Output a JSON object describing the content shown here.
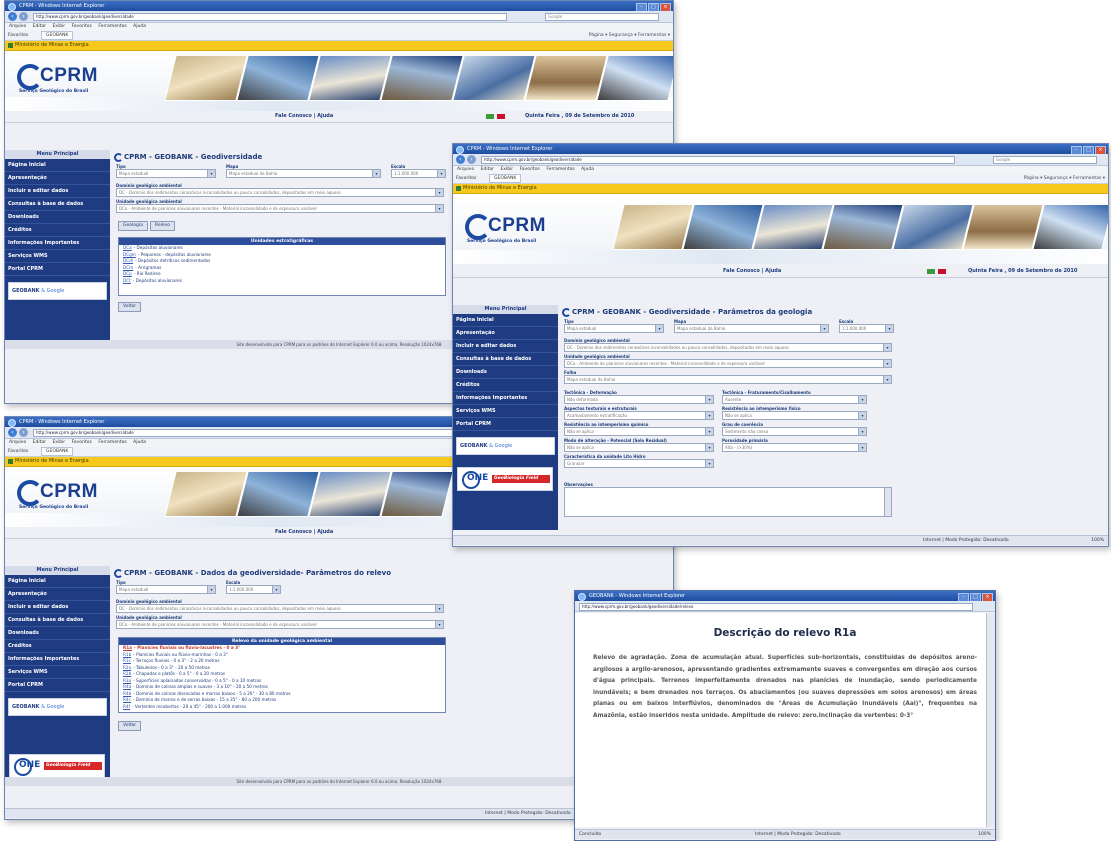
{
  "browser": {
    "window_title": "CPRM - Windows Internet Explorer",
    "url": "http://www.cprm.gov.br/geobank/geodiversidade",
    "search_placeholder": "Google",
    "menu": [
      "Arquivo",
      "Editar",
      "Exibir",
      "Favoritos",
      "Ferramentas",
      "Ajuda"
    ],
    "favorites_label": "Favoritos",
    "tab_label": "GEOBANK",
    "tools": "Página ▾  Segurança ▾  Ferramentas ▾",
    "ministry_bar": "Ministério de Minas e Energia"
  },
  "site": {
    "logo_text": "CPRM",
    "logo_sub": "Serviço Geológico do Brasil",
    "contact": "Fale Conosco | Ajuda",
    "date": "Quinta Feira , 09 de Setembro de 2010",
    "sidebar_head": "Menu Principal",
    "sidebar_items": [
      "Página Inicial",
      "Apresentação",
      "Incluir e editar dados",
      "Consultas à base de dados",
      "Downloads",
      "Créditos",
      "Informações Importantes",
      "Serviços WMS",
      "Portal CPRM"
    ],
    "geobank_label": "GEOBANK",
    "google_label": "& Google",
    "one_label": "ONE",
    "one_tag": "GeoBiologia Field",
    "footer_text": "Site desenvolvido para CPRM para os padrões do Internet Explorer 6.0 ou acima. Resolução 1024x768",
    "status_done": "Concluído",
    "status_zone": "Internet | Modo Protegido: Desativado",
    "status_zoom": "100%"
  },
  "window1": {
    "page_title": "CPRM - GEOBANK - Geodiversidade",
    "labels": {
      "tipo": "Tipo",
      "mapa": "Mapa",
      "escala": "Escala",
      "dominio": "Domínio geológico ambiental",
      "unidade": "Unidade geológica ambiental"
    },
    "values": {
      "tipo": "Mapa estadual",
      "mapa": "Mapa estadual da Bahia",
      "escala": "1:1.000.000",
      "dominio": "DC - Domínio dos sedimentos cenozóicos inconsolidados ou pouco consolidados, depositados em meio aquoso",
      "unidade": "DCa - Ambiente de planícies aluvionares recentes - Material inconsolidado e de espessura variável"
    },
    "buttons": [
      "Geologia",
      "Relevo"
    ],
    "legend_title": "Unidades estratigráficas",
    "legend_rows": [
      {
        "code": "DCa",
        "text": "- Depósitos aluvionares"
      },
      {
        "code": "DCgm",
        "text": "- Pequenos - depósitos aluvionares"
      },
      {
        "code": "DCdl",
        "text": "- Depósitos detríticos sedimentados"
      },
      {
        "code": "DCm",
        "text": "- Arrigramas"
      },
      {
        "code": "DCp",
        "text": "- Rio Redireo"
      },
      {
        "code": "DCt",
        "text": "- Depósitos aluvionares"
      }
    ],
    "back_button": "Voltar"
  },
  "window2": {
    "page_title": "CPRM - GEOBANK - Geodiversidade - Parâmetros da geologia",
    "labels": {
      "tipo": "Tipo",
      "mapa": "Mapa",
      "escala": "Escala",
      "dominio": "Domínio geológico ambiental",
      "unidade": "Unidade geológica ambiental",
      "folha": "Folha",
      "tectonica_def": "Tectônica - Deformação",
      "tectonica_frat": "Tectônica - Fraturamento/Cisalhamento",
      "aspectos": "Aspectos texturais e estruturais",
      "resist_intemp_fisico": "Resistência ao intemperismo físico",
      "resist_intemp_quimico": "Resistência ao intemperismo químico",
      "grau_coerencia": "Grau de coerência",
      "porosidade": "Porosidade primária",
      "modo_alteracao": "Modo de alteração - Potencial (Solo Residual)",
      "caracteristica": "Característica da unidade Lito Hidro",
      "observacoes": "Observações"
    },
    "values": {
      "tipo": "Mapa estadual",
      "mapa": "Mapa estadual da Bahia",
      "escala": "1:1.000.000",
      "dominio": "DC - Domínio dos sedimentos cenozóicos inconsolidados ou pouco consolidados, depositados em meio aquoso",
      "unidade": "DCa - Ambiente de planícies aluvionares recentes - Material inconsolidado e de espessura variável",
      "folha": "Mapa estadual da Bahia",
      "tectonica_def": "Não deformada",
      "tectonica_frat": "Ausente",
      "aspectos": "Acamadamento estratificação",
      "resist_intemp_fisico": "Não se aplica",
      "resist_intemp_quimico": "Não se aplica",
      "grau_coerencia": "Sedimento não coeso",
      "porosidade": "Alta - (>30%)",
      "modo_alteracao": "Não se aplica",
      "caracteristica": "Granular"
    }
  },
  "window3": {
    "page_title": "CPRM - GEOBANK - Dados da geodiversidade- Parâmetros do relevo",
    "labels": {
      "tipo": "Tipo",
      "escala": "Escala",
      "dominio": "Domínio geológico ambiental",
      "unidade": "Unidade geológica ambiental"
    },
    "values": {
      "tipo": "Mapa estadual",
      "escala": "1:1.000.000",
      "dominio": "DC - Domínio dos sedimentos cenozóicos inconsolidados ou pouco consolidados, depositados em meio aquoso",
      "unidade": "DCa - Ambiente de planícies aluvionares recentes - Material inconsolidado e de espessura variável"
    },
    "legend_title": "Relevo da unidade geológica ambiental",
    "legend_rows": [
      {
        "code": "R1a",
        "text": "- Planícies fluviais ou flúvio-lacustres - 0 a 3°",
        "selected": true
      },
      {
        "code": "R1b",
        "text": "- Planícies fluviais ou flúvio-marinhas - 0 a 3°"
      },
      {
        "code": "R1c",
        "text": "- Terraços fluviais - 0 a 3° - 2 a 20 metros"
      },
      {
        "code": "R2a",
        "text": "- Tabuleiros - 0 a 3° - 20 a 50 metros"
      },
      {
        "code": "R2b",
        "text": "- Chapadas e platôs - 0 a 5° - 0 a 20 metros"
      },
      {
        "code": "R3a",
        "text": "- Superfícies aplainadas conservadas - 0 a 5° - 0 a 10 metros"
      },
      {
        "code": "R4a",
        "text": "- Domínio de colinas amplas e suaves - 3 a 10° - 20 a 50 metros"
      },
      {
        "code": "R4b",
        "text": "- Domínio de colinas dissecadas e morros baixos - 5 a 20° - 30 a 80 metros"
      },
      {
        "code": "R4c",
        "text": "- Domínio de morros e de serras baixas - 15 a 35° - 80 a 200 metros"
      },
      {
        "code": "R4f",
        "text": "- Vertentes recobertas - 20 a 45° - 200 a 1.000 metros"
      }
    ],
    "back_button": "Voltar"
  },
  "popup": {
    "window_title": "GEOBANK - Windows Internet Explorer",
    "url": "http://www.cprm.gov.br/geobank/geodiversidade/relevo",
    "title": "Descrição do relevo R1a",
    "text": "Relevo de agradação. Zona de acumulação atual. Superfícies sub-horizontais, constituídas de depósitos areno-argilosos a argilo-arenosos, apresentando gradientes extremamente suaves e convergentes em direção aos cursos d'água principais. Terrenos imperfeitamente drenados nas planícies de inundação, sendo periodicamente inundáveis; e bem drenados nos terraços. Os abaciamentos (ou suaves depressões em solos arenosos) em áreas planas ou em baixos interflúvios, denominados de \"Áreas de Acumulação Inundáveis (Aai)\", frequentes na Amazônia, estão inseridos nesta unidade. Amplitude de relevo: zero.Inclinação da vertentes: 0-3°"
  },
  "colors": {
    "sidebar": "#1f3c82",
    "ministry_bar": "#f8c91d",
    "titlebar": "#1d4d9e",
    "selected_legend": "#c0392b"
  }
}
